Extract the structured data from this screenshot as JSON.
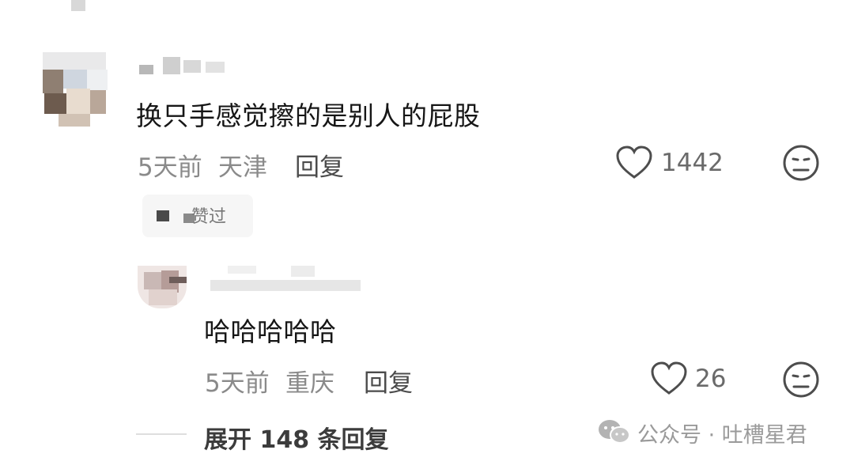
{
  "comments": [
    {
      "text": "换只手感觉擦的是别人的屁股",
      "age": "5天前",
      "location": "天津",
      "reply_label": "回复",
      "likes": "1442",
      "liked_by_author_label": "赞过"
    }
  ],
  "reply": {
    "text": "哈哈哈哈哈",
    "age": "5天前",
    "location": "重庆",
    "reply_label": "回复",
    "likes": "26"
  },
  "expand": {
    "label": "展开 148 条回复"
  },
  "watermark": {
    "label": "公众号 · 吐槽星君",
    "icon": "wechat-icon"
  },
  "icons": {
    "like": "heart-outline-icon",
    "dislike": "neutral-face-icon"
  }
}
